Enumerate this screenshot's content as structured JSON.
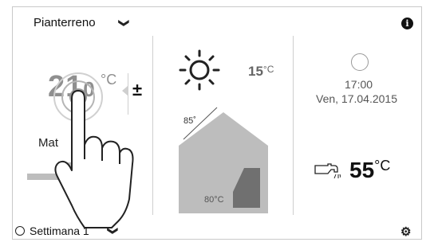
{
  "header": {
    "zone": "Pianterreno",
    "info_icon": "info-icon"
  },
  "room": {
    "temperature": "21",
    "decimal": "0",
    "unit": "°C",
    "adjust": "±",
    "mode_label": "Mat"
  },
  "weather": {
    "icon": "sun-icon",
    "outdoor_temp": "15",
    "outdoor_unit": "°C"
  },
  "house": {
    "top_label": "85˚",
    "bottom_label": "80°C"
  },
  "clock": {
    "time": "17:00",
    "date": "Ven, 17.04.2015"
  },
  "hot_water": {
    "icon": "faucet-icon",
    "temperature": "55",
    "unit": "°C"
  },
  "footer": {
    "program_icon": "clock-icon",
    "program": "Settimana 1",
    "settings_icon": "gear-icon"
  },
  "colors": {
    "house": "#bdbdbd",
    "tank": "#707070",
    "frame": "#c9c9c9",
    "hand_stroke": "#222222"
  }
}
